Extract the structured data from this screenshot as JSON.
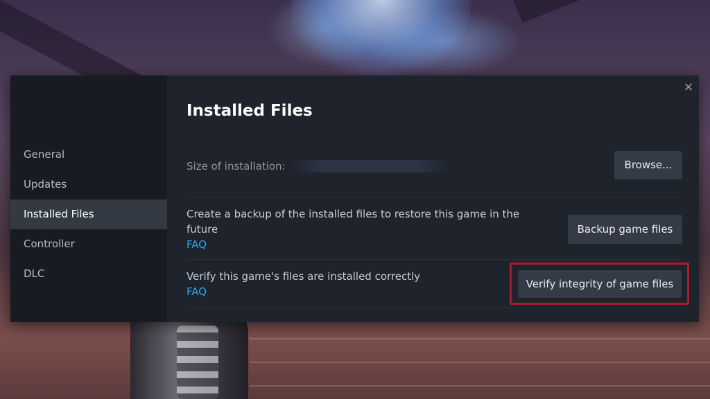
{
  "sidebar": {
    "items": [
      {
        "label": "General",
        "active": false
      },
      {
        "label": "Updates",
        "active": false
      },
      {
        "label": "Installed Files",
        "active": true
      },
      {
        "label": "Controller",
        "active": false
      },
      {
        "label": "DLC",
        "active": false
      }
    ]
  },
  "main": {
    "title": "Installed Files",
    "close_icon": "×",
    "size": {
      "label": "Size of installation:",
      "button": "Browse..."
    },
    "backup": {
      "text": "Create a backup of the installed files to restore this game in the future",
      "faq": "FAQ",
      "button": "Backup game files"
    },
    "verify": {
      "text": "Verify this game's files are installed correctly",
      "faq": "FAQ",
      "button": "Verify integrity of game files"
    }
  },
  "colors": {
    "accent_link": "#3aa2e8",
    "highlight": "#b01a28",
    "active_item_bg": "#333a44"
  }
}
